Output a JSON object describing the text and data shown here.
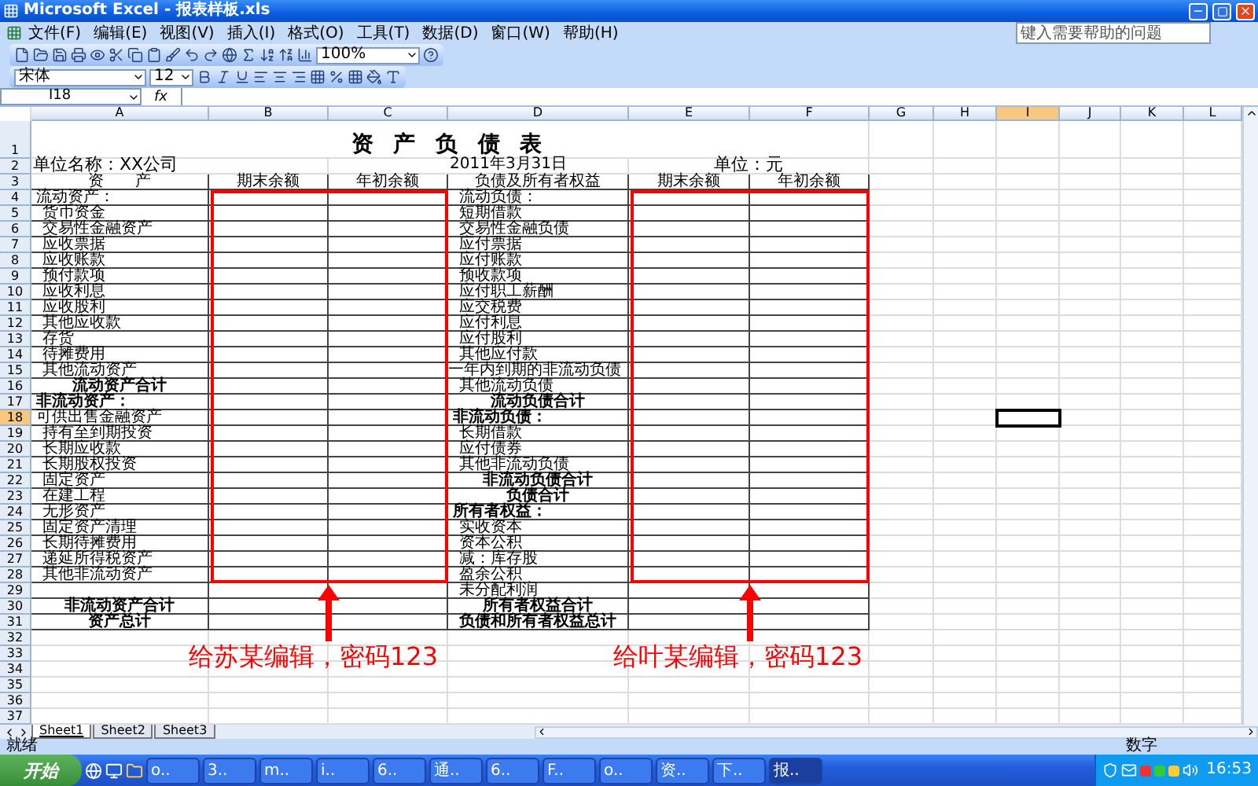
{
  "window": {
    "title": "Microsoft Excel - 报表样板.xls"
  },
  "menu": [
    {
      "label": "文件(F)"
    },
    {
      "label": "编辑(E)"
    },
    {
      "label": "视图(V)"
    },
    {
      "label": "插入(I)"
    },
    {
      "label": "格式(O)"
    },
    {
      "label": "工具(T)"
    },
    {
      "label": "数据(D)"
    },
    {
      "label": "窗口(W)"
    },
    {
      "label": "帮助(H)"
    }
  ],
  "help_box": {
    "placeholder": "键入需要帮助的问题"
  },
  "toolbar": {
    "zoom": "100%"
  },
  "format_toolbar": {
    "font": "宋体",
    "size": "12"
  },
  "formula_bar": {
    "name_box": "I18",
    "function_label": "fx"
  },
  "column_headers": [
    {
      "label": "A",
      "selected": false
    },
    {
      "label": "B",
      "selected": false
    },
    {
      "label": "C",
      "selected": false
    },
    {
      "label": "D",
      "selected": false
    },
    {
      "label": "E",
      "selected": false
    },
    {
      "label": "F",
      "selected": false
    },
    {
      "label": "G",
      "selected": false
    },
    {
      "label": "H",
      "selected": false
    },
    {
      "label": "I",
      "selected": true
    },
    {
      "label": "J",
      "selected": false
    },
    {
      "label": "K",
      "selected": false
    },
    {
      "label": "L",
      "selected": false
    }
  ],
  "row_headers": [
    {
      "label": "1",
      "selected": false
    },
    {
      "label": "2",
      "selected": false
    },
    {
      "label": "3",
      "selected": false
    },
    {
      "label": "4",
      "selected": false
    },
    {
      "label": "5",
      "selected": false
    },
    {
      "label": "6",
      "selected": false
    },
    {
      "label": "7",
      "selected": false
    },
    {
      "label": "8",
      "selected": false
    },
    {
      "label": "9",
      "selected": false
    },
    {
      "label": "10",
      "selected": false
    },
    {
      "label": "11",
      "selected": false
    },
    {
      "label": "12",
      "selected": false
    },
    {
      "label": "13",
      "selected": false
    },
    {
      "label": "14",
      "selected": false
    },
    {
      "label": "15",
      "selected": false
    },
    {
      "label": "16",
      "selected": false
    },
    {
      "label": "17",
      "selected": false
    },
    {
      "label": "18",
      "selected": true
    },
    {
      "label": "19",
      "selected": false
    },
    {
      "label": "20",
      "selected": false
    },
    {
      "label": "21",
      "selected": false
    },
    {
      "label": "22",
      "selected": false
    },
    {
      "label": "23",
      "selected": false
    },
    {
      "label": "24",
      "selected": false
    },
    {
      "label": "25",
      "selected": false
    },
    {
      "label": "26",
      "selected": false
    },
    {
      "label": "27",
      "selected": false
    },
    {
      "label": "28",
      "selected": false
    },
    {
      "label": "29",
      "selected": false
    },
    {
      "label": "30",
      "selected": false
    },
    {
      "label": "31",
      "selected": false
    },
    {
      "label": "32",
      "selected": false
    },
    {
      "label": "33",
      "selected": false
    },
    {
      "label": "34",
      "selected": false
    },
    {
      "label": "35",
      "selected": false
    },
    {
      "label": "36",
      "selected": false
    },
    {
      "label": "37",
      "selected": false
    }
  ],
  "sheet": {
    "title": "资 产 负 债 表",
    "company": "单位名称：XX公司",
    "date": "2011年3月31日",
    "unit": "单位：元",
    "header": [
      "资　　产",
      "期末余额",
      "年初余额",
      "负债及所有者权益",
      "期末余额",
      "年初余额"
    ],
    "rows": [
      {
        "asset": {
          "text": "流动资产：",
          "kind": "plain"
        },
        "liability": {
          "text": "流动负债：",
          "kind": "item"
        }
      },
      {
        "asset": {
          "text": "货币资金",
          "kind": "item"
        },
        "liability": {
          "text": "短期借款",
          "kind": "item"
        }
      },
      {
        "asset": {
          "text": "交易性金融资产",
          "kind": "item"
        },
        "liability": {
          "text": "交易性金融负债",
          "kind": "item"
        }
      },
      {
        "asset": {
          "text": "应收票据",
          "kind": "item"
        },
        "liability": {
          "text": "应付票据",
          "kind": "item"
        }
      },
      {
        "asset": {
          "text": "应收账款",
          "kind": "item"
        },
        "liability": {
          "text": "应付账款",
          "kind": "item"
        }
      },
      {
        "asset": {
          "text": "预付款项",
          "kind": "item"
        },
        "liability": {
          "text": "预收款项",
          "kind": "item"
        }
      },
      {
        "asset": {
          "text": "应收利息",
          "kind": "item"
        },
        "liability": {
          "text": "应付职工薪酬",
          "kind": "item"
        }
      },
      {
        "asset": {
          "text": "应收股利",
          "kind": "item"
        },
        "liability": {
          "text": "应交税费",
          "kind": "item"
        }
      },
      {
        "asset": {
          "text": "其他应收款",
          "kind": "item"
        },
        "liability": {
          "text": "应付利息",
          "kind": "item"
        }
      },
      {
        "asset": {
          "text": "存货",
          "kind": "item"
        },
        "liability": {
          "text": "应付股利",
          "kind": "item"
        }
      },
      {
        "asset": {
          "text": "待摊费用",
          "kind": "item"
        },
        "liability": {
          "text": "其他应付款",
          "kind": "item"
        }
      },
      {
        "asset": {
          "text": "其他流动资产",
          "kind": "item"
        },
        "liability": {
          "text": "一年内到期的非流动负债",
          "kind": "flush"
        }
      },
      {
        "asset": {
          "text": "流动资产合计",
          "kind": "total"
        },
        "liability": {
          "text": "其他流动负债",
          "kind": "item"
        }
      },
      {
        "asset": {
          "text": "非流动资产：",
          "kind": "section"
        },
        "liability": {
          "text": "流动负债合计",
          "kind": "total"
        }
      },
      {
        "asset": {
          "text": "可供出售金融资产",
          "kind": "plain"
        },
        "liability": {
          "text": "非流动负债：",
          "kind": "section"
        }
      },
      {
        "asset": {
          "text": "持有至到期投资",
          "kind": "item"
        },
        "liability": {
          "text": "长期借款",
          "kind": "item"
        }
      },
      {
        "asset": {
          "text": "长期应收款",
          "kind": "item"
        },
        "liability": {
          "text": "应付债券",
          "kind": "item"
        }
      },
      {
        "asset": {
          "text": "长期股权投资",
          "kind": "item"
        },
        "liability": {
          "text": "其他非流动负债",
          "kind": "item"
        }
      },
      {
        "asset": {
          "text": "固定资产",
          "kind": "item"
        },
        "liability": {
          "text": "非流动负债合计",
          "kind": "total"
        }
      },
      {
        "asset": {
          "text": "在建工程",
          "kind": "item"
        },
        "liability": {
          "text": "负债合计",
          "kind": "total"
        }
      },
      {
        "asset": {
          "text": "无形资产",
          "kind": "item"
        },
        "liability": {
          "text": "所有者权益：",
          "kind": "section"
        }
      },
      {
        "asset": {
          "text": "固定资产清理",
          "kind": "item"
        },
        "liability": {
          "text": "实收资本",
          "kind": "item"
        }
      },
      {
        "asset": {
          "text": "长期待摊费用",
          "kind": "item"
        },
        "liability": {
          "text": "资本公积",
          "kind": "item"
        }
      },
      {
        "asset": {
          "text": "递延所得税资产",
          "kind": "item"
        },
        "liability": {
          "text": "减：库存股",
          "kind": "item"
        }
      },
      {
        "asset": {
          "text": "其他非流动资产",
          "kind": "item"
        },
        "liability": {
          "text": "盈余公积",
          "kind": "item"
        }
      },
      {
        "liability": {
          "text": "未分配利润",
          "kind": "item"
        }
      },
      {
        "asset": {
          "text": "非流动资产合计",
          "kind": "total"
        },
        "liability": {
          "text": "所有者权益合计",
          "kind": "total"
        }
      },
      {
        "asset": {
          "text": "资产总计",
          "kind": "total"
        },
        "liability": {
          "text": "负债和所有者权益总计",
          "kind": "total"
        }
      }
    ]
  },
  "annotations": [
    {
      "text": "给苏某编辑，密码123"
    },
    {
      "text": "给叶某编辑，密码123"
    }
  ],
  "sheet_tabs": [
    {
      "label": "Sheet1",
      "selected": true
    },
    {
      "label": "Sheet2",
      "selected": false
    },
    {
      "label": "Sheet3",
      "selected": false
    }
  ],
  "status_bar": {
    "status": "就绪",
    "mode": "数字"
  },
  "taskbar": {
    "start": "开始",
    "tasks": [
      {
        "label": "o..",
        "selected": false
      },
      {
        "label": "3..",
        "selected": false
      },
      {
        "label": "m..",
        "selected": false
      },
      {
        "label": "i..",
        "selected": false
      },
      {
        "label": "6..",
        "selected": false
      },
      {
        "label": "通..",
        "selected": false
      },
      {
        "label": "6..",
        "selected": false
      },
      {
        "label": "F..",
        "selected": false
      },
      {
        "label": "o..",
        "selected": false
      },
      {
        "label": "资..",
        "selected": false
      },
      {
        "label": "下..",
        "selected": false
      },
      {
        "label": "报..",
        "selected": true
      }
    ],
    "clock": "16:53"
  }
}
